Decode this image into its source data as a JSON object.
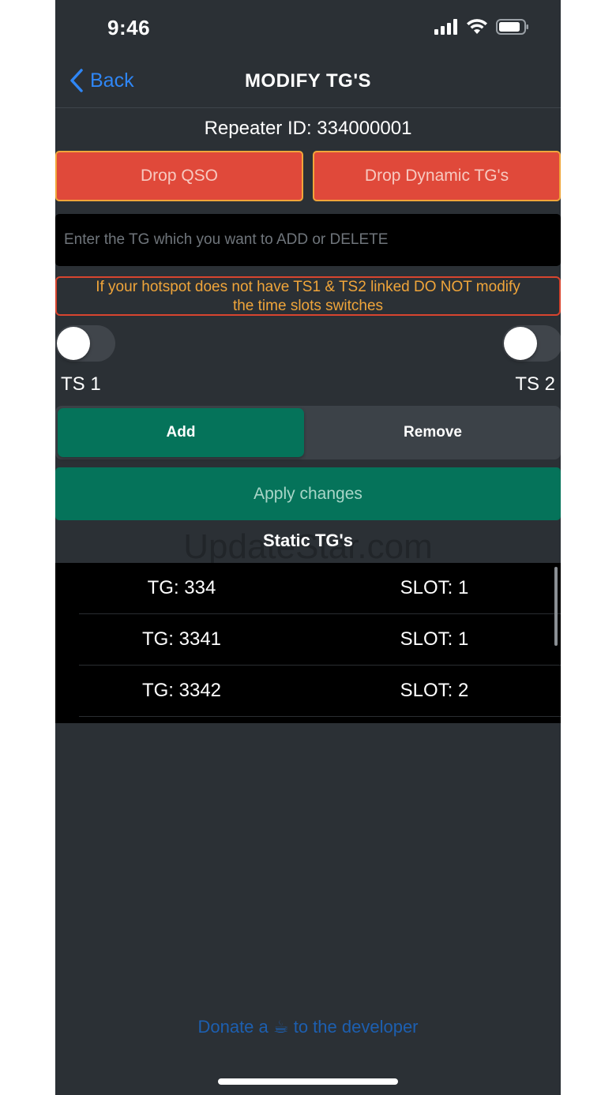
{
  "status_bar": {
    "time": "9:46",
    "icons": [
      "cellular-signal-icon",
      "wifi-icon",
      "battery-icon"
    ]
  },
  "nav": {
    "back_label": "Back",
    "title": "MODIFY TG'S"
  },
  "repeater_id": "Repeater ID: 334000001",
  "actions": {
    "drop_qso": "Drop QSO",
    "drop_dynamic": "Drop Dynamic TG's"
  },
  "tg_input": {
    "placeholder": "Enter the TG which you want to ADD or DELETE",
    "value": ""
  },
  "warning": {
    "line1": "If your hotspot does not have TS1 & TS2 linked DO NOT modify",
    "line2": "the time slots switches"
  },
  "timeslots": {
    "ts1_label": "TS 1",
    "ts2_label": "TS 2",
    "ts1_on": false,
    "ts2_on": false
  },
  "mode": {
    "add_label": "Add",
    "remove_label": "Remove",
    "selected": "Add"
  },
  "apply_label": "Apply changes",
  "static_title": "Static TG's",
  "watermark": "UpdateStar.com",
  "static_tgs": [
    {
      "tg": "TG: 334",
      "slot": "SLOT: 1"
    },
    {
      "tg": "TG: 3341",
      "slot": "SLOT: 1"
    },
    {
      "tg": "TG: 3342",
      "slot": "SLOT: 2"
    }
  ],
  "donate": {
    "before": "Donate a ",
    "emoji": "☕",
    "after": " to the developer"
  },
  "colors": {
    "background": "#2b3035",
    "accent_blue": "#2f86f5",
    "danger": "#e0493a",
    "warning": "#f0a53a",
    "success": "#05735a"
  }
}
